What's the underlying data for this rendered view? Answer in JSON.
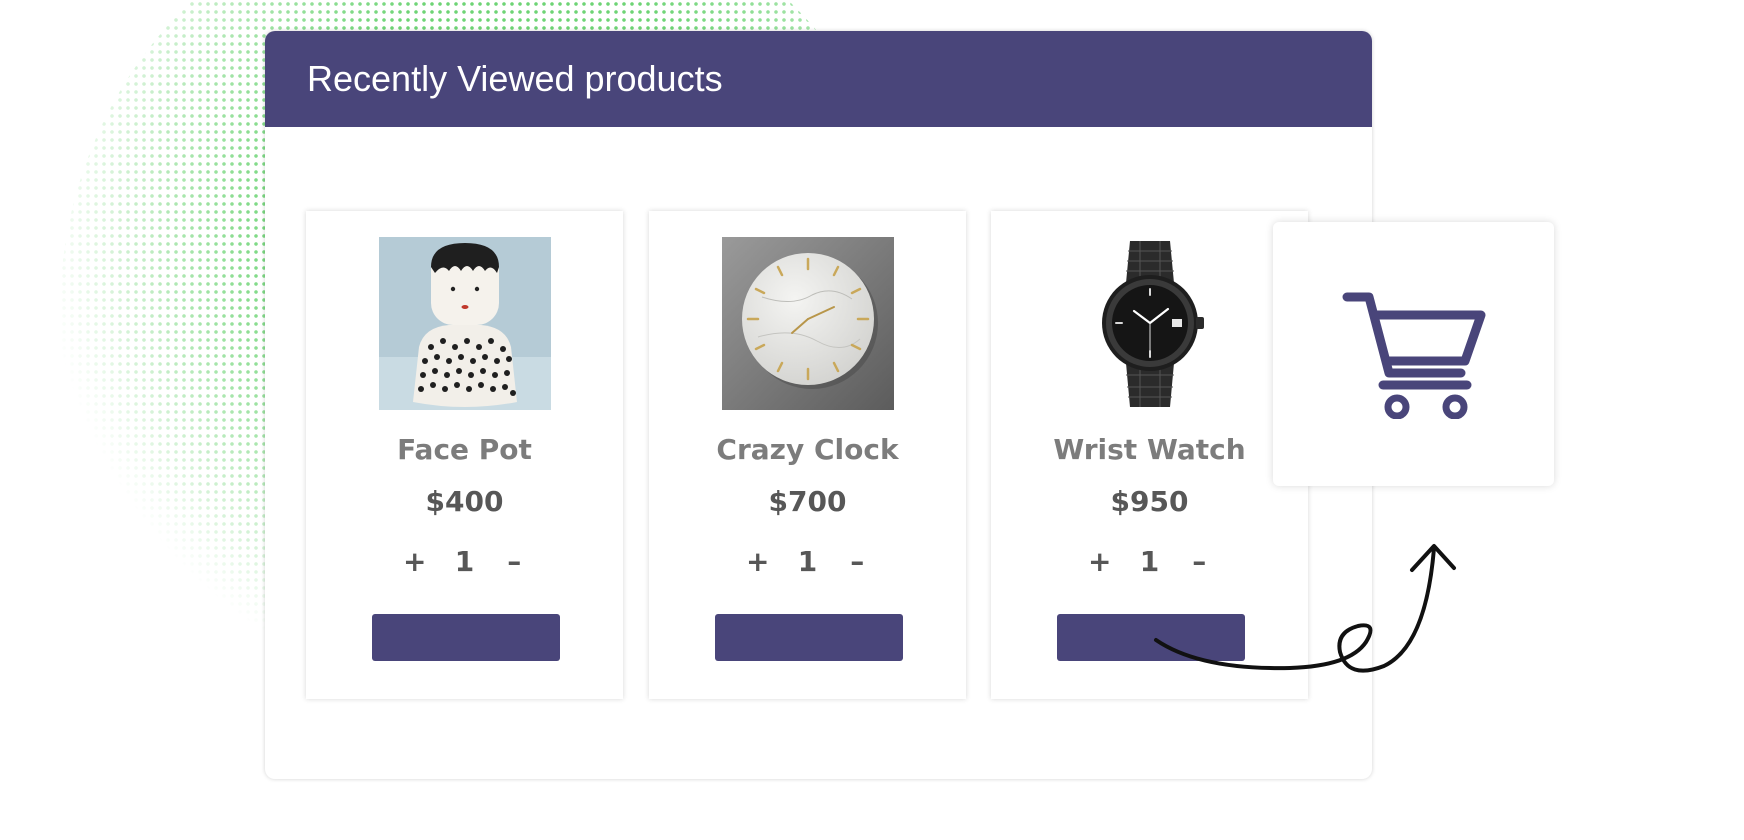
{
  "widget": {
    "title": "Recently Viewed products"
  },
  "products": [
    {
      "name": "Face Pot",
      "price": "$400",
      "qty_plus": "+",
      "qty_value": "1",
      "qty_minus": "–",
      "image": "face-pot-vase-photo"
    },
    {
      "name": "Crazy Clock",
      "price": "$700",
      "qty_plus": "+",
      "qty_value": "1",
      "qty_minus": "–",
      "image": "marble-wall-clock-photo"
    },
    {
      "name": "Wrist Watch",
      "price": "$950",
      "qty_plus": "+",
      "qty_value": "1",
      "qty_minus": "–",
      "image": "black-wrist-watch-photo"
    }
  ],
  "cart": {
    "icon": "shopping-cart-icon"
  },
  "colors": {
    "brand": "#49457a",
    "dots": "#5fd067",
    "product_name": "#7c7c7c",
    "price": "#575757"
  }
}
